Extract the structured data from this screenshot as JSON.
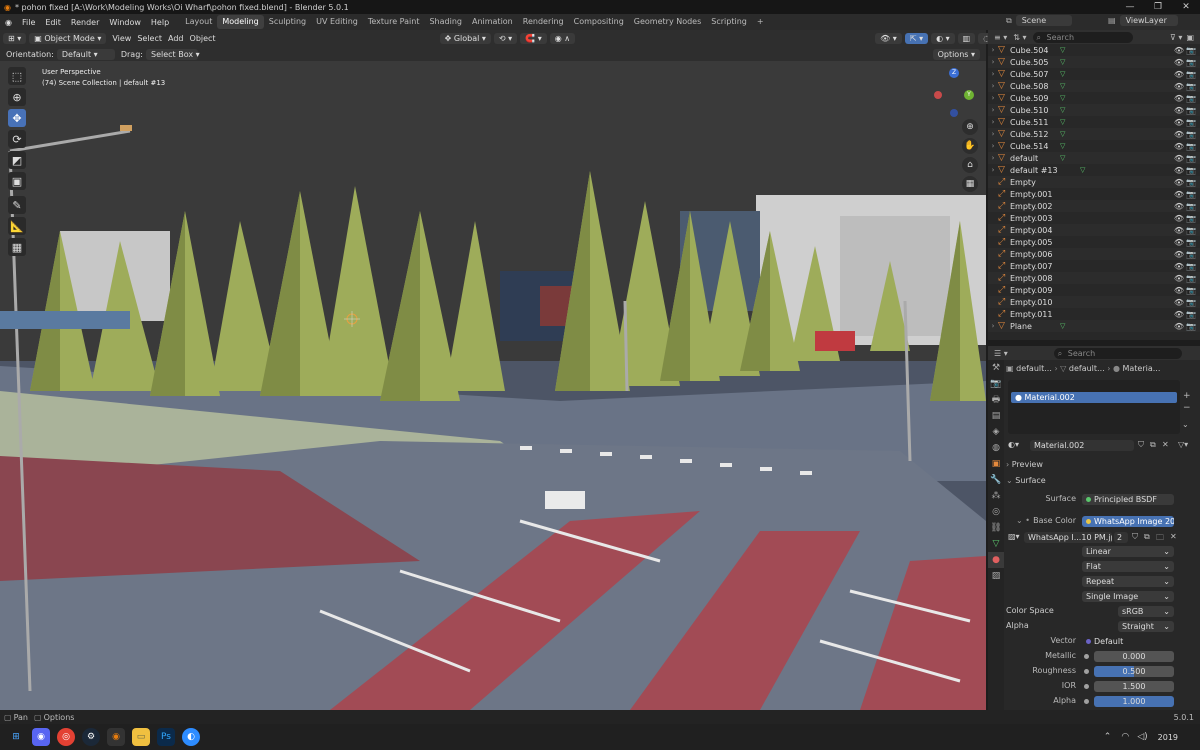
{
  "window": {
    "title": "* pohon fixed [A:\\Work\\Modeling Works\\Oi Wharf\\pohon fixed.blend] - Blender 5.0.1",
    "minimize": "—",
    "maximize": "❐",
    "close": "✕"
  },
  "menu": {
    "items": [
      "File",
      "Edit",
      "Render",
      "Window",
      "Help"
    ],
    "workspaces": [
      "Layout",
      "Modeling",
      "Sculpting",
      "UV Editing",
      "Texture Paint",
      "Shading",
      "Animation",
      "Rendering",
      "Compositing",
      "Geometry Nodes",
      "Scripting"
    ],
    "active_workspace": "Modeling",
    "add_workspace": "+",
    "scene": "Scene",
    "view_layer": "ViewLayer"
  },
  "viewport_header": {
    "mode": "Object Mode",
    "menus": [
      "View",
      "Select",
      "Add",
      "Object"
    ],
    "transform_orientation": "Global",
    "orientation_label": "Orientation:",
    "orientation_value": "Default",
    "drag_label": "Drag:",
    "drag_value": "Select Box",
    "options": "Options"
  },
  "viewport": {
    "view_name": "User Perspective",
    "collection_info": "(74) Scene Collection | default #13",
    "gizmo_z": "Z",
    "gizmo_y": "Y"
  },
  "outliner": {
    "search_placeholder": "Search",
    "rows": [
      {
        "name": "Cube.504",
        "mesh": true,
        "expand": true
      },
      {
        "name": "Cube.505",
        "mesh": true,
        "expand": true
      },
      {
        "name": "Cube.507",
        "mesh": true,
        "expand": true
      },
      {
        "name": "Cube.508",
        "mesh": true,
        "expand": true
      },
      {
        "name": "Cube.509",
        "mesh": true,
        "expand": true
      },
      {
        "name": "Cube.510",
        "mesh": true,
        "expand": true
      },
      {
        "name": "Cube.511",
        "mesh": true,
        "expand": true
      },
      {
        "name": "Cube.512",
        "mesh": true,
        "expand": true
      },
      {
        "name": "Cube.514",
        "mesh": true,
        "expand": true
      },
      {
        "name": "default",
        "mesh": true,
        "expand": true
      },
      {
        "name": "default #13",
        "mesh": true,
        "expand": true
      },
      {
        "name": "Empty",
        "mesh": false,
        "expand": false
      },
      {
        "name": "Empty.001",
        "mesh": false,
        "expand": false
      },
      {
        "name": "Empty.002",
        "mesh": false,
        "expand": false
      },
      {
        "name": "Empty.003",
        "mesh": false,
        "expand": false
      },
      {
        "name": "Empty.004",
        "mesh": false,
        "expand": false
      },
      {
        "name": "Empty.005",
        "mesh": false,
        "expand": false
      },
      {
        "name": "Empty.006",
        "mesh": false,
        "expand": false
      },
      {
        "name": "Empty.007",
        "mesh": false,
        "expand": false
      },
      {
        "name": "Empty.008",
        "mesh": false,
        "expand": false
      },
      {
        "name": "Empty.009",
        "mesh": false,
        "expand": false
      },
      {
        "name": "Empty.010",
        "mesh": false,
        "expand": false
      },
      {
        "name": "Empty.011",
        "mesh": false,
        "expand": false
      },
      {
        "name": "Plane",
        "mesh": true,
        "expand": true
      }
    ]
  },
  "properties": {
    "search_placeholder": "Search",
    "breadcrumb": [
      "default...",
      "default...",
      "Materia..."
    ],
    "slot": "Material.002",
    "material_name": "Material.002",
    "sections": {
      "preview": "Preview",
      "surface": "Surface"
    },
    "surface_label": "Surface",
    "surface_value": "Principled BSDF",
    "base_color_label": "Base Color",
    "base_color_value": "WhatsApp Image 202...",
    "image_name": "WhatsApp I...10 PM.jpeg",
    "image_users": "2",
    "interpolation": "Linear",
    "projection": "Flat",
    "extension": "Repeat",
    "source": "Single Image",
    "color_space_label": "Color Space",
    "color_space_value": "sRGB",
    "alpha_mode_label": "Alpha",
    "alpha_mode_value": "Straight",
    "vector_label": "Vector",
    "vector_value": "Default",
    "metallic_label": "Metallic",
    "metallic_value": "0.000",
    "roughness_label": "Roughness",
    "roughness_value": "0.500",
    "ior_label": "IOR",
    "ior_value": "1.500",
    "alpha_label": "Alpha",
    "alpha_value": "1.000"
  },
  "status": {
    "left1": "Pan",
    "left2": "Options",
    "version": "5.0.1"
  },
  "taskbar": {
    "time": "2019"
  }
}
